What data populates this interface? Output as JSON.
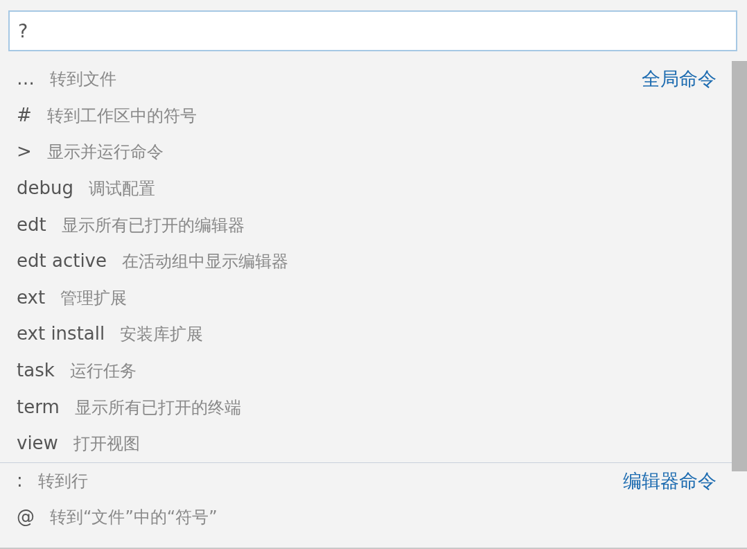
{
  "search": {
    "value": "?"
  },
  "groups": [
    {
      "label": "全局命令",
      "items": [
        {
          "prefix": "…",
          "description": "转到文件"
        },
        {
          "prefix": "#",
          "description": "转到工作区中的符号"
        },
        {
          "prefix": ">",
          "description": "显示并运行命令"
        },
        {
          "prefix": "debug",
          "description": "调试配置"
        },
        {
          "prefix": "edt",
          "description": "显示所有已打开的编辑器"
        },
        {
          "prefix": "edt active",
          "description": "在活动组中显示编辑器"
        },
        {
          "prefix": "ext",
          "description": "管理扩展"
        },
        {
          "prefix": "ext install",
          "description": "安装库扩展"
        },
        {
          "prefix": "task",
          "description": "运行任务"
        },
        {
          "prefix": "term",
          "description": "显示所有已打开的终端"
        },
        {
          "prefix": "view",
          "description": "打开视图"
        }
      ]
    },
    {
      "label": "编辑器命令",
      "items": [
        {
          "prefix": ":",
          "description": "转到行"
        },
        {
          "prefix": "@",
          "description": "转到“文件”中的“符号”"
        }
      ]
    }
  ]
}
